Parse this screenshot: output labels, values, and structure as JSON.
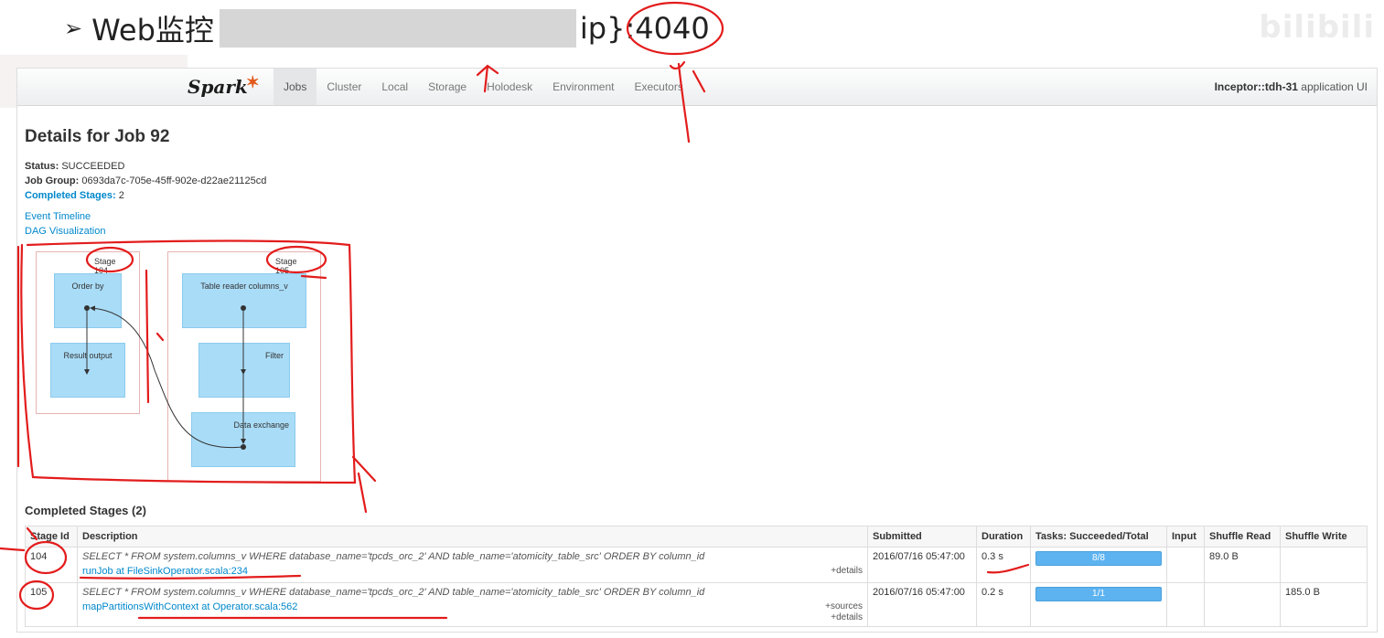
{
  "slide": {
    "title_prefix": "Web监控",
    "title_suffix": "ip}:4040",
    "watermark": "bilibili",
    "colors": {
      "annotation": "#e31c1c"
    }
  },
  "navbar": {
    "logo": "Spark",
    "tabs": [
      "Jobs",
      "Cluster",
      "Local",
      "Storage",
      "Holodesk",
      "Environment",
      "Executors"
    ],
    "active_tab": "Jobs",
    "app_name_bold": "Inceptor::tdh-31",
    "app_name_rest": "application UI"
  },
  "job": {
    "title": "Details for Job 92",
    "status_label": "Status:",
    "status_value": "SUCCEEDED",
    "group_label": "Job Group:",
    "group_value": "0693da7c-705e-45ff-902e-d22ae21125cd",
    "completed_label": "Completed Stages:",
    "completed_value": "2",
    "event_timeline": "Event Timeline",
    "dag_visualization": "DAG Visualization"
  },
  "dag": {
    "stage_a": {
      "label": "Stage 104",
      "nodes": [
        "Order by",
        "Result output"
      ]
    },
    "stage_b": {
      "label": "Stage 105",
      "nodes": [
        "Table reader columns_v",
        "Filter",
        "Data exchange"
      ]
    }
  },
  "completed_stages": {
    "heading": "Completed Stages (2)",
    "columns": [
      "Stage Id",
      "Description",
      "Submitted",
      "Duration",
      "Tasks: Succeeded/Total",
      "Input",
      "Shuffle Read",
      "Shuffle Write"
    ],
    "rows": [
      {
        "id": "104",
        "query": "SELECT * FROM system.columns_v WHERE database_name='tpcds_orc_2' AND table_name='atomicity_table_src' ORDER BY column_id",
        "link": "runJob at FileSinkOperator.scala:234",
        "extra1": "",
        "extra2": "+details",
        "submitted": "2016/07/16 05:47:00",
        "duration": "0.3 s",
        "tasks": "8/8",
        "tasks_fraction": 1.0,
        "input": "",
        "shuffle_read": "89.0 B",
        "shuffle_write": ""
      },
      {
        "id": "105",
        "query": "SELECT * FROM system.columns_v WHERE database_name='tpcds_orc_2' AND table_name='atomicity_table_src' ORDER BY column_id",
        "link": "mapPartitionsWithContext at Operator.scala:562",
        "extra1": "+sources",
        "extra2": "+details",
        "submitted": "2016/07/16 05:47:00",
        "duration": "0.2 s",
        "tasks": "1/1",
        "tasks_fraction": 1.0,
        "input": "",
        "shuffle_read": "",
        "shuffle_write": "185.0 B"
      }
    ]
  }
}
